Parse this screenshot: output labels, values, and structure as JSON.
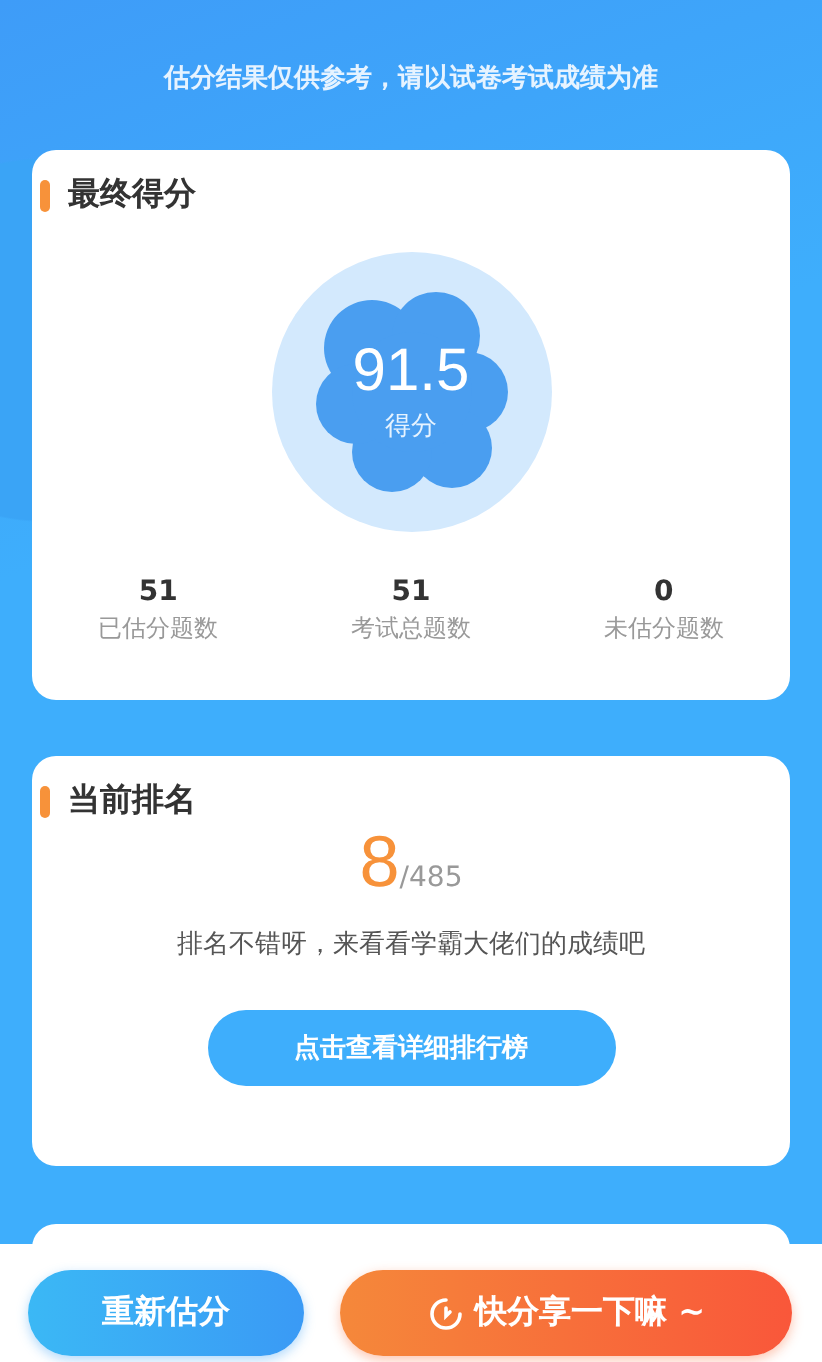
{
  "notice": "估分结果仅供参考，请以试卷考试成绩为准",
  "final_score": {
    "title": "最终得分",
    "score": "91.5",
    "score_label": "得分",
    "stats": [
      {
        "value": "51",
        "label": "已估分题数"
      },
      {
        "value": "51",
        "label": "考试总题数"
      },
      {
        "value": "0",
        "label": "未估分题数"
      }
    ]
  },
  "ranking": {
    "title": "当前排名",
    "rank": "8",
    "total": "/485",
    "message": "排名不错呀，来看看学霸大佬们的成绩吧",
    "button": "点击查看详细排行榜"
  },
  "actions": [
    {
      "kind": "secondary",
      "label": "重新估分"
    },
    {
      "kind": "primary",
      "label": "快分享一下嘛 ~"
    }
  ]
}
